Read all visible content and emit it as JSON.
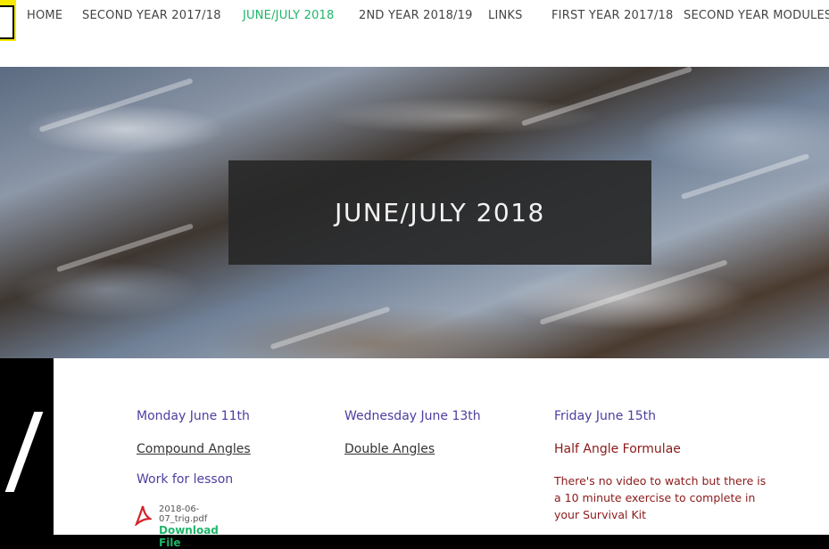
{
  "nav": {
    "items": [
      {
        "label": "HOME",
        "active": false
      },
      {
        "label": "SECOND YEAR 2017/18",
        "active": false
      },
      {
        "label": "JUNE/JULY 2018",
        "active": true
      },
      {
        "label": "2ND YEAR 2018/19",
        "active": false
      },
      {
        "label": "LINKS",
        "active": false
      },
      {
        "label": "FIRST YEAR 2017/18",
        "active": false
      },
      {
        "label": "SECOND YEAR MODULES",
        "active": false
      }
    ],
    "active_color": "#1fb66a"
  },
  "hero": {
    "title": "JUNE/JULY 2018"
  },
  "columns": [
    {
      "day": "Monday June 11th",
      "link": "Compound Angles",
      "work_label": "Work for lesson",
      "file": {
        "name": "2018-06-07_trig.pdf",
        "download_label": "Download File",
        "icon": "pdf-icon"
      }
    },
    {
      "day": "Wednesday June 13th",
      "link": "Double Angles"
    },
    {
      "day": "Friday June 15th",
      "heading": "Half Angle Formulae",
      "text": "There's no video to watch but there is a 10 minute exercise to complete in your Survival Kit"
    }
  ]
}
